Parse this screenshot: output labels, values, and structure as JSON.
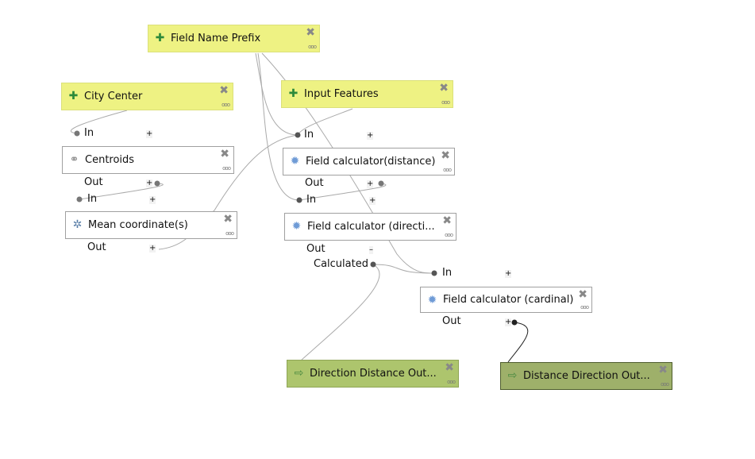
{
  "inputs": [
    {
      "label": "Field Name Prefix"
    },
    {
      "label": "City Center"
    },
    {
      "label": "Input Features"
    }
  ],
  "algorithms": [
    {
      "label": "Centroids",
      "in": "In",
      "out": "Out",
      "out_toggle": "+",
      "in_toggle": "+"
    },
    {
      "label": "Field calculator(distance)",
      "in": "In",
      "out": "Out",
      "out_toggle": "+",
      "in_toggle": "+"
    },
    {
      "label": "Mean coordinate(s)",
      "in": "In",
      "out": "Out",
      "out_toggle": "+",
      "in_toggle": "+"
    },
    {
      "label": "Field calculator (directi...",
      "in": "In",
      "out": "Out",
      "out_toggle": "–",
      "in_toggle": "+",
      "extra_out": "Calculated"
    },
    {
      "label": "Field calculator (cardinal)",
      "in": "In",
      "out": "Out",
      "out_toggle": "+",
      "in_toggle": "+"
    }
  ],
  "outputs": [
    {
      "label": "Direction Distance Out..."
    },
    {
      "label": "Distance Direction Out..."
    }
  ],
  "icons": {
    "input": "plus-icon",
    "algorithm": "gear-icon",
    "output": "arrow-right-icon",
    "delete": "close-icon",
    "more": "more-icon"
  },
  "glyphs": {
    "delete": "✖",
    "more": "ooo",
    "plus": "✚",
    "gear": "✹",
    "arrow": "⇨",
    "centroids": "⚭",
    "mean": "✲"
  },
  "colors": {
    "input": "#eef283",
    "algorithm": "#ffffff",
    "output": "#adc56d",
    "output_selected": "#9eb06a"
  }
}
